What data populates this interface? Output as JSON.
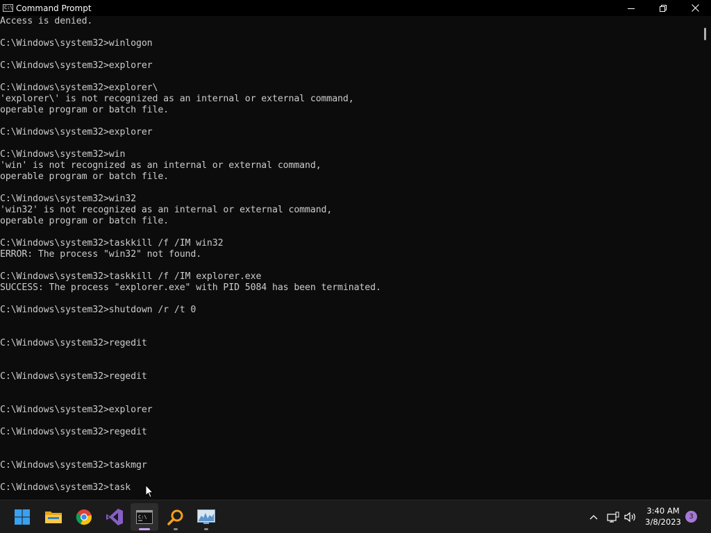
{
  "window": {
    "title": "Command Prompt",
    "icon_text": "C:\\",
    "minimize_icon": "minimize-icon",
    "maximize_icon": "restore-icon",
    "close_icon": "close-icon"
  },
  "console": {
    "lines": [
      "Access is denied.",
      "",
      "C:\\Windows\\system32>winlogon",
      "",
      "C:\\Windows\\system32>explorer",
      "",
      "C:\\Windows\\system32>explorer\\",
      "'explorer\\' is not recognized as an internal or external command,",
      "operable program or batch file.",
      "",
      "C:\\Windows\\system32>explorer",
      "",
      "C:\\Windows\\system32>win",
      "'win' is not recognized as an internal or external command,",
      "operable program or batch file.",
      "",
      "C:\\Windows\\system32>win32",
      "'win32' is not recognized as an internal or external command,",
      "operable program or batch file.",
      "",
      "C:\\Windows\\system32>taskkill /f /IM win32",
      "ERROR: The process \"win32\" not found.",
      "",
      "C:\\Windows\\system32>taskkill /f /IM explorer.exe",
      "SUCCESS: The process \"explorer.exe\" with PID 5084 has been terminated.",
      "",
      "C:\\Windows\\system32>shutdown /r /t 0",
      "",
      "",
      "C:\\Windows\\system32>regedit",
      "",
      "",
      "C:\\Windows\\system32>regedit",
      "",
      "",
      "C:\\Windows\\system32>explorer",
      "",
      "C:\\Windows\\system32>regedit",
      "",
      "",
      "C:\\Windows\\system32>taskmgr",
      "",
      "C:\\Windows\\system32>task"
    ]
  },
  "taskbar": {
    "apps": [
      {
        "name": "start",
        "icon": "windows-start-icon",
        "active": false
      },
      {
        "name": "file-explorer",
        "icon": "folder-icon",
        "active": false
      },
      {
        "name": "chrome",
        "icon": "chrome-icon",
        "active": false
      },
      {
        "name": "visual-studio",
        "icon": "visual-studio-icon",
        "active": false
      },
      {
        "name": "command-prompt",
        "icon": "terminal-icon",
        "active": true
      },
      {
        "name": "magnifier",
        "icon": "magnifier-icon",
        "active": false
      },
      {
        "name": "resource-monitor",
        "icon": "monitor-chart-icon",
        "active": false
      }
    ],
    "tray": {
      "chevron_icon": "chevron-up-icon",
      "network_icon": "network-icon",
      "volume_icon": "volume-icon",
      "time": "3:40 AM",
      "date": "3/8/2023",
      "notification_count": "3"
    }
  },
  "colors": {
    "console_bg": "#0c0c0c",
    "console_fg": "#cccccc",
    "taskbar_bg": "#1b1b1b",
    "accent": "#a678d6"
  }
}
